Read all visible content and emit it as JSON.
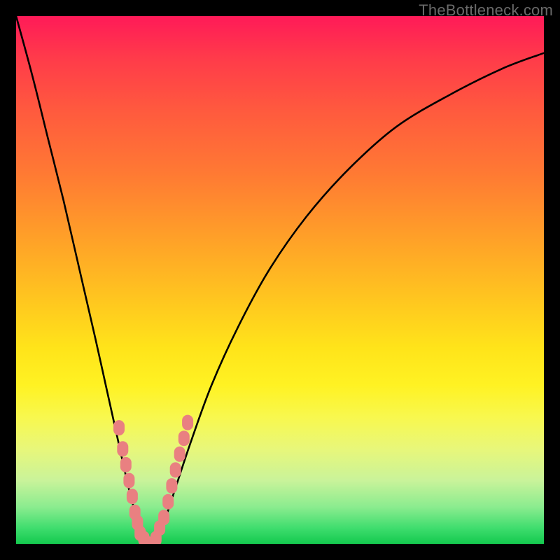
{
  "watermark": "TheBottleneck.com",
  "chart_data": {
    "type": "line",
    "title": "",
    "xlabel": "",
    "ylabel": "",
    "xlim": [
      0,
      100
    ],
    "ylim": [
      0,
      100
    ],
    "series": [
      {
        "name": "bottleneck-curve",
        "x": [
          0,
          3,
          6,
          9,
          12,
          15,
          17,
          19,
          21,
          22,
          23,
          24,
          25,
          26,
          27,
          28,
          30,
          33,
          37,
          42,
          48,
          55,
          63,
          72,
          82,
          92,
          100
        ],
        "y": [
          100,
          89,
          77,
          65,
          52,
          39,
          30,
          21,
          12,
          8,
          4,
          1,
          0,
          0,
          2,
          4,
          10,
          19,
          30,
          41,
          52,
          62,
          71,
          79,
          85,
          90,
          93
        ]
      }
    ],
    "markers": {
      "name": "marker-dots",
      "color": "#e98081",
      "x": [
        19.5,
        20.2,
        20.8,
        21.4,
        22.0,
        22.5,
        23.0,
        23.5,
        24.2,
        25.0,
        25.8,
        26.5,
        27.2,
        28.0,
        28.8,
        29.5,
        30.2,
        31.0,
        31.8,
        32.5
      ],
      "y": [
        22,
        18,
        15,
        12,
        9,
        6,
        4,
        2,
        1,
        0,
        0,
        1,
        3,
        5,
        8,
        11,
        14,
        17,
        20,
        23
      ]
    },
    "gradient_stops": [
      {
        "pos": 0,
        "color": "#ff1a58"
      },
      {
        "pos": 8,
        "color": "#ff3b4a"
      },
      {
        "pos": 18,
        "color": "#ff5a3e"
      },
      {
        "pos": 30,
        "color": "#ff7a33"
      },
      {
        "pos": 42,
        "color": "#ffa028"
      },
      {
        "pos": 54,
        "color": "#ffc71f"
      },
      {
        "pos": 63,
        "color": "#ffe41a"
      },
      {
        "pos": 70,
        "color": "#fff223"
      },
      {
        "pos": 76,
        "color": "#f8f84e"
      },
      {
        "pos": 82,
        "color": "#e8f77a"
      },
      {
        "pos": 88,
        "color": "#c9f39a"
      },
      {
        "pos": 93,
        "color": "#8bec8f"
      },
      {
        "pos": 97,
        "color": "#3fdd6e"
      },
      {
        "pos": 100,
        "color": "#14c94e"
      }
    ]
  }
}
